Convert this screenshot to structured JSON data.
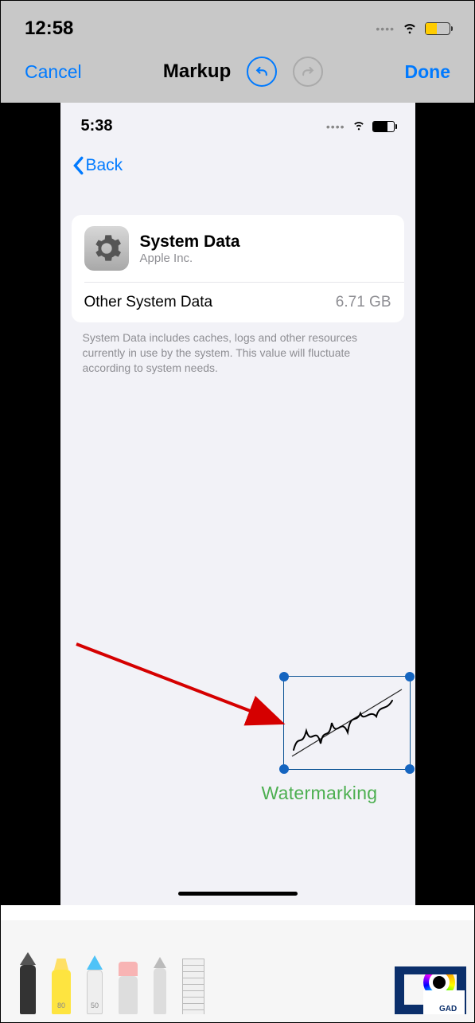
{
  "outer_status": {
    "time": "12:58"
  },
  "editor": {
    "cancel": "Cancel",
    "title": "Markup",
    "done": "Done"
  },
  "inner_status": {
    "time": "5:38"
  },
  "back_label": "Back",
  "card": {
    "title": "System Data",
    "vendor": "Apple Inc.",
    "row_label": "Other System Data",
    "row_value": "6.71 GB"
  },
  "footnote": "System Data includes caches, logs and other resources currently in use by the system. This value will fluctuate according to system needs.",
  "annotation": {
    "signature_text": "water",
    "label": "Watermarking"
  },
  "tools": {
    "hl_num": "80",
    "pc_num": "50"
  },
  "logo_text": "GAD"
}
